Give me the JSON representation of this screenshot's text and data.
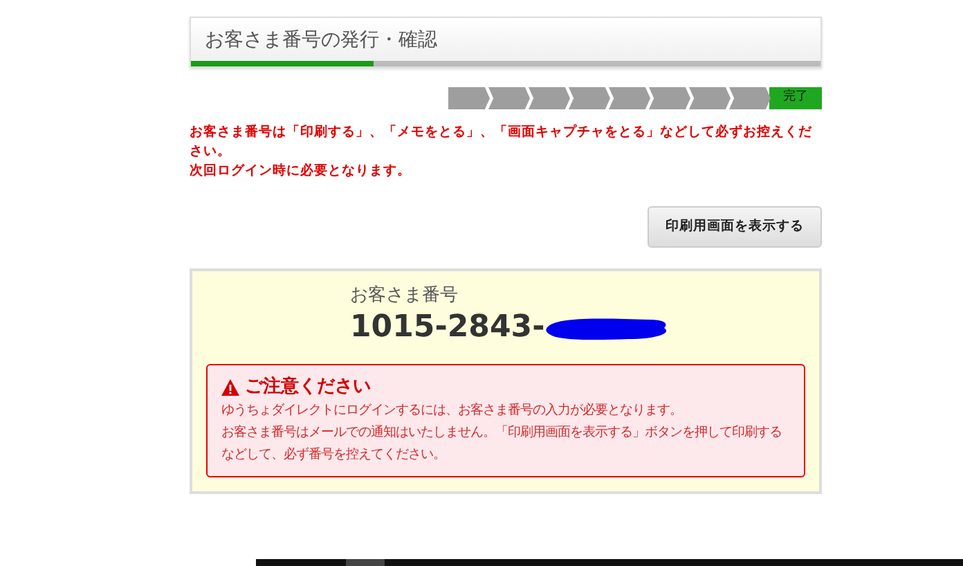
{
  "header": {
    "title": "お客さま番号の発行・確認",
    "progress": {
      "level": 0.29
    }
  },
  "steps": [
    {
      "selected": false
    },
    {
      "selected": false
    },
    {
      "selected": false
    },
    {
      "selected": false
    },
    {
      "selected": false
    },
    {
      "selected": false
    },
    {
      "selected": false
    },
    {
      "selected": false
    },
    {
      "label": "完了",
      "selected": true
    }
  ],
  "notice": [
    "お客さま番号は「印刷する」、「メモをとる」、「画面キャプチャをとる」などして必ずお控えください。",
    "次回ログイン時に必要となります。"
  ],
  "print_button": "印刷用画面を表示する",
  "customer_number": {
    "label": "お客さま番号",
    "value": "1015-2843-",
    "redacted": true
  },
  "caution": {
    "title": "ご注意ください",
    "lines": [
      "ゆうちょダイレクトにログインするには、お客さま番号の入力が必要となります。",
      "お客さま番号はメールでの通知はいたしません。「印刷用画面を表示する」ボタンを押して印刷するなどして、必ず番号を控えてください。"
    ]
  }
}
